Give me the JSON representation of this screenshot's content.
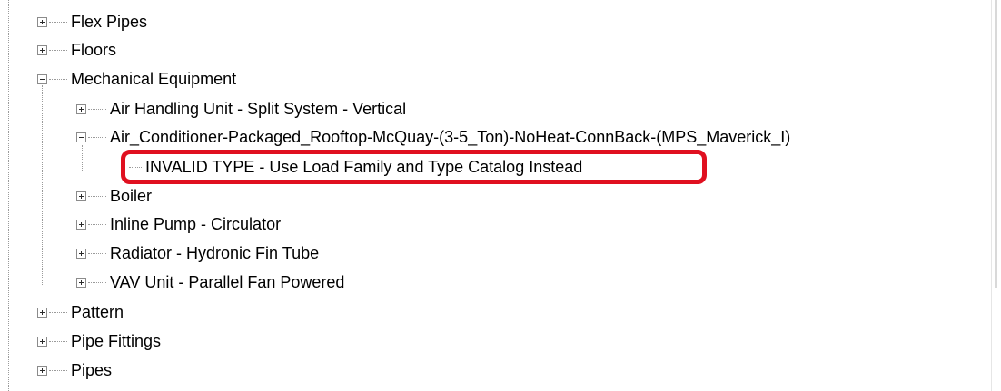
{
  "tree": {
    "items": [
      {
        "label": "Flex Pipes",
        "level": 0,
        "state": "collapsed"
      },
      {
        "label": "Floors",
        "level": 0,
        "state": "collapsed"
      },
      {
        "label": "Mechanical Equipment",
        "level": 0,
        "state": "expanded"
      },
      {
        "label": "Air Handling Unit - Split System - Vertical",
        "level": 1,
        "state": "collapsed"
      },
      {
        "label": "Air_Conditioner-Packaged_Rooftop-McQuay-(3-5_Ton)-NoHeat-ConnBack-(MPS_Maverick_I)",
        "level": 1,
        "state": "expanded"
      },
      {
        "label": "INVALID TYPE - Use Load Family and Type Catalog Instead",
        "level": 2,
        "state": "leaf"
      },
      {
        "label": "Boiler",
        "level": 1,
        "state": "collapsed"
      },
      {
        "label": "Inline Pump - Circulator",
        "level": 1,
        "state": "collapsed"
      },
      {
        "label": "Radiator - Hydronic Fin Tube",
        "level": 1,
        "state": "collapsed"
      },
      {
        "label": "VAV Unit - Parallel Fan Powered",
        "level": 1,
        "state": "collapsed"
      },
      {
        "label": "Pattern",
        "level": 0,
        "state": "collapsed"
      },
      {
        "label": "Pipe Fittings",
        "level": 0,
        "state": "collapsed"
      },
      {
        "label": "Pipes",
        "level": 0,
        "state": "collapsed"
      }
    ]
  },
  "annotation": {
    "highlight_color": "#e01020",
    "highlighted_item": "INVALID TYPE - Use Load Family and Type Catalog Instead"
  }
}
